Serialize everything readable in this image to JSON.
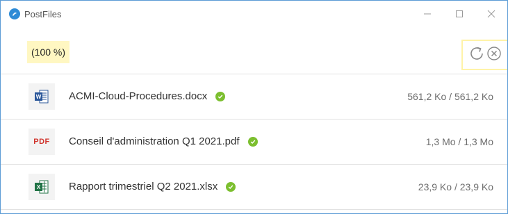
{
  "window": {
    "title": "PostFiles",
    "controls": {
      "minimize": "—",
      "maximize": "☐",
      "close": "✕"
    }
  },
  "toolbar": {
    "progress": "(100 %)",
    "actions": [
      {
        "icon": "refresh-icon"
      },
      {
        "icon": "cancel-icon"
      }
    ]
  },
  "files": [
    {
      "name": "ACMI-Cloud-Procedures.docx",
      "type": "word",
      "size": "561,2 Ko / 561,2 Ko",
      "status": "complete"
    },
    {
      "name": "Conseil d'administration Q1 2021.pdf",
      "type": "pdf",
      "icon_text": "PDF",
      "size": "1,3 Mo / 1,3 Mo",
      "status": "complete"
    },
    {
      "name": "Rapport trimestriel Q2 2021.xlsx",
      "type": "excel",
      "size": "23,9 Ko / 23,9 Ko",
      "status": "complete"
    }
  ],
  "colors": {
    "accent": "#2e8bd6",
    "progress_highlight": "#fff7c2",
    "success": "#7cbf2f",
    "word": "#2b579a",
    "excel": "#217346",
    "pdf": "#d0342c"
  }
}
